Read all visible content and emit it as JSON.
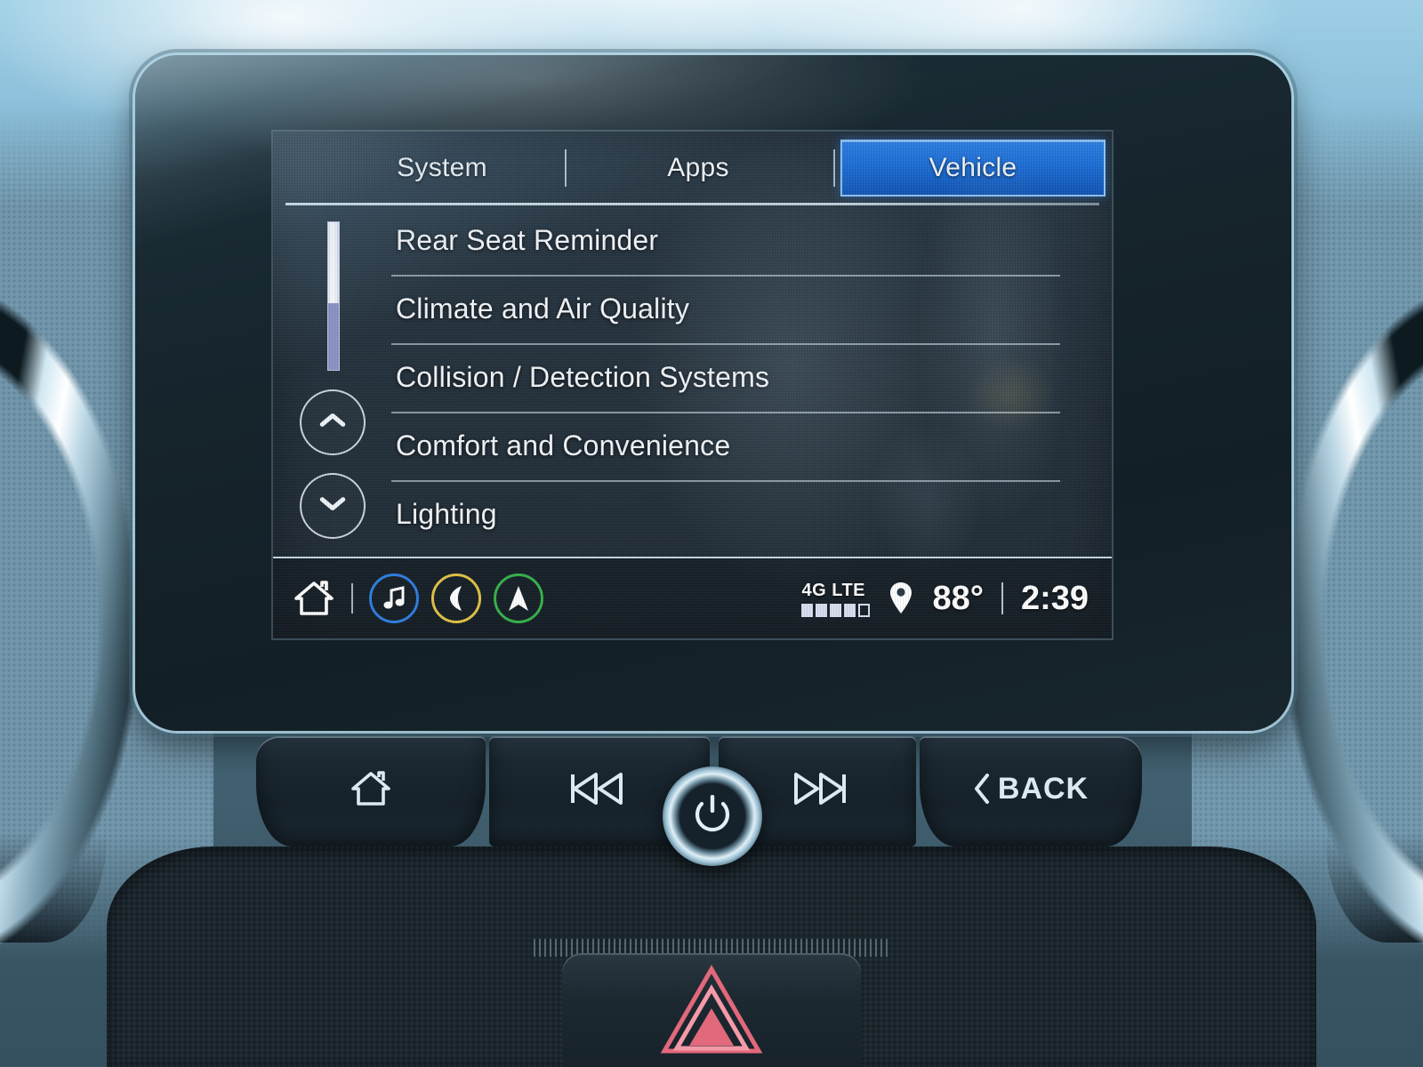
{
  "screen": {
    "tabs": [
      {
        "label": "System",
        "active": false
      },
      {
        "label": "Apps",
        "active": false
      },
      {
        "label": "Vehicle",
        "active": true
      }
    ],
    "menu": {
      "items": [
        {
          "label": "Rear Seat Reminder"
        },
        {
          "label": "Climate and Air Quality"
        },
        {
          "label": "Collision / Detection Systems"
        },
        {
          "label": "Comfort and Convenience"
        },
        {
          "label": "Lighting"
        }
      ],
      "scroll_up_icon": "chevron-up-icon",
      "scroll_down_icon": "chevron-down-icon",
      "scrollbar_thumb_percent": 55
    },
    "status_bar": {
      "home_icon": "home-icon",
      "shortcuts": [
        {
          "icon": "music-note-icon",
          "color": "#2f7fe0"
        },
        {
          "icon": "phone-icon",
          "color": "#e0c348"
        },
        {
          "icon": "navigation-arrow-icon",
          "color": "#37b24d"
        }
      ],
      "network_label": "4G LTE",
      "signal_bars_filled": 4,
      "signal_bars_total": 5,
      "location_icon": "location-pin-icon",
      "temperature": "88°",
      "time": "2:39"
    }
  },
  "hardware": {
    "buttons": [
      {
        "name": "home",
        "icon": "home-icon",
        "label": ""
      },
      {
        "name": "previous",
        "icon": "rewind-icon",
        "label": ""
      },
      {
        "name": "power",
        "icon": "power-icon",
        "label": ""
      },
      {
        "name": "next",
        "icon": "fast-forward-icon",
        "label": ""
      },
      {
        "name": "back",
        "icon": "chevron-left-icon",
        "label": "BACK"
      }
    ],
    "hazard_icon": "hazard-triangle-icon"
  },
  "colors": {
    "accent_blue": "#1f6fd6",
    "tab_border": "#8fc2f2",
    "music_blue": "#2f7fe0",
    "phone_yellow": "#e0c348",
    "nav_green": "#37b24d",
    "hazard_red": "#d6455a",
    "scroll_track": "#8d93c4"
  }
}
